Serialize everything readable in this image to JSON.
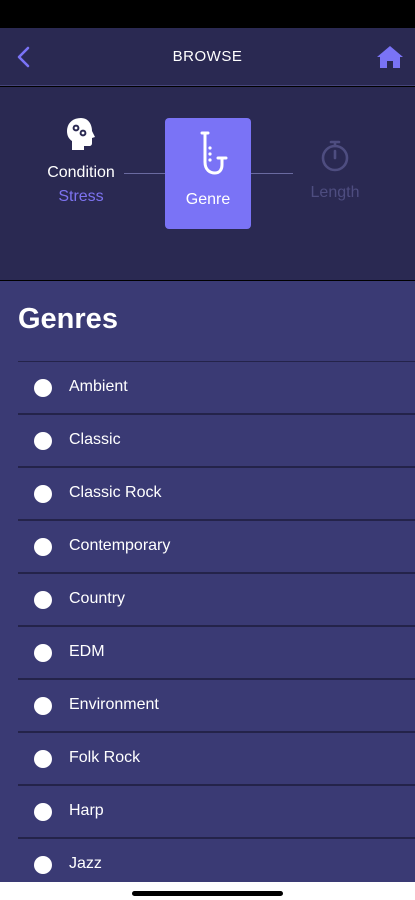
{
  "header": {
    "title": "BROWSE",
    "back_icon": "chevron-left-icon",
    "home_icon": "home-icon",
    "accent_color": "#7a73f6"
  },
  "steps": {
    "condition": {
      "icon": "head-brain-icon",
      "label": "Condition",
      "value": "Stress"
    },
    "genre": {
      "icon": "saxophone-icon",
      "label": "Genre",
      "active": true
    },
    "length": {
      "icon": "stopwatch-icon",
      "label": "Length"
    }
  },
  "main": {
    "title": "Genres",
    "genres": [
      {
        "label": "Ambient"
      },
      {
        "label": "Classic"
      },
      {
        "label": "Classic Rock"
      },
      {
        "label": "Contemporary"
      },
      {
        "label": "Country"
      },
      {
        "label": "EDM"
      },
      {
        "label": "Environment"
      },
      {
        "label": "Folk Rock"
      },
      {
        "label": "Harp"
      },
      {
        "label": "Jazz"
      }
    ]
  },
  "colors": {
    "header_bg": "#2a2952",
    "content_bg": "#3a3a74",
    "divider": "#24234a",
    "inactive_step": "#4e4d80"
  }
}
